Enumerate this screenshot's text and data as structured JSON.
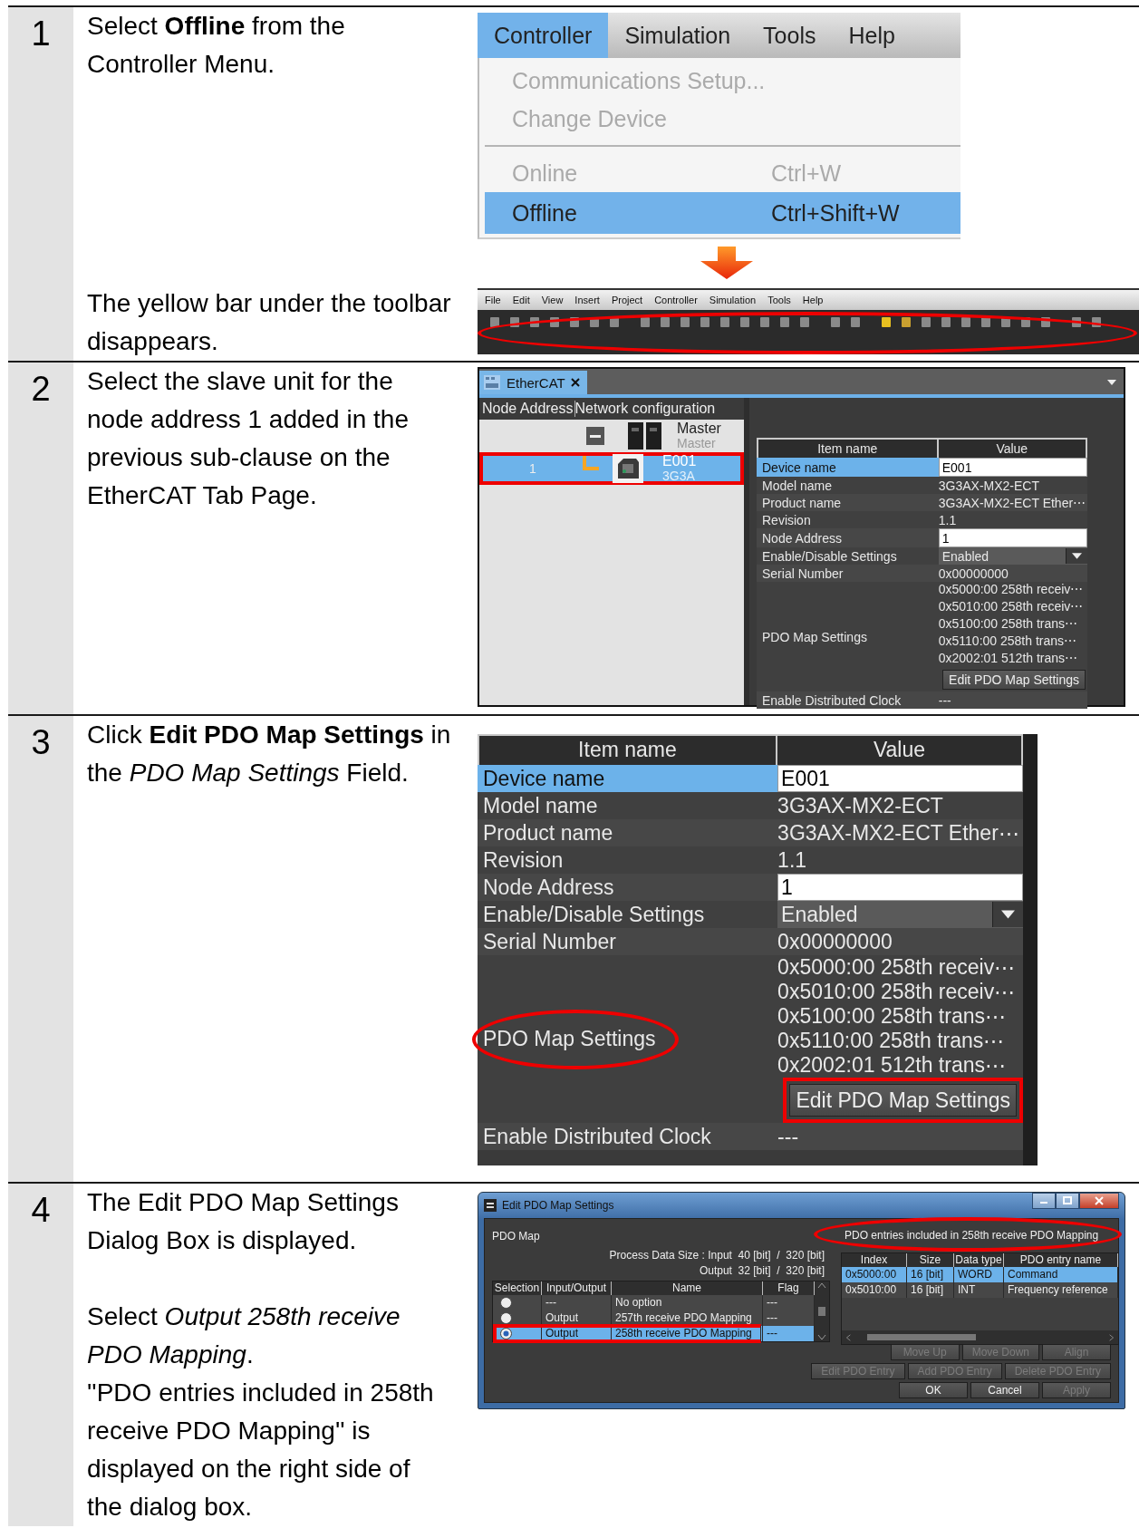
{
  "steps": [
    {
      "number": "1",
      "parts": [
        {
          "text": [
            [
              "Select **Offline** from the Controller Menu."
            ]
          ],
          "figure": {
            "kind": "menu",
            "menus": [
              {
                "label": "Controller",
                "selected": true
              },
              {
                "label": "Simulation",
                "selected": false
              },
              {
                "label": "Tools",
                "selected": false
              },
              {
                "label": "Help",
                "selected": false
              }
            ],
            "items": [
              {
                "kind": "item",
                "label": "Communications Setup...",
                "disabled": true,
                "selected": false
              },
              {
                "kind": "item",
                "label": "Change Device",
                "disabled": true,
                "selected": false
              },
              {
                "kind": "separator"
              },
              {
                "kind": "item",
                "label": "Online",
                "shortcut": "Ctrl+W",
                "disabled": true,
                "selected": false
              },
              {
                "kind": "item",
                "label": "Offline",
                "shortcut": "Ctrl+Shift+W",
                "disabled": false,
                "selected": true
              }
            ]
          }
        },
        {
          "text": [
            [
              "The yellow bar under the toolbar disappears."
            ]
          ],
          "figure": {
            "kind": "toolbar",
            "menus": [
              "File",
              "Edit",
              "View",
              "Insert",
              "Project",
              "Controller",
              "Simulation",
              "Tools",
              "Help"
            ],
            "circled": true
          }
        }
      ]
    },
    {
      "number": "2",
      "parts": [
        {
          "text": [
            [
              "Select the slave unit for the node address 1 added in the previous sub-clause on the EtherCAT Tab Page."
            ]
          ],
          "figure": {
            "kind": "ethercat",
            "tab": {
              "label": "EtherCAT",
              "selected": true
            },
            "columns": [
              "Node Address",
              "Network configuration"
            ],
            "nodes": [
              {
                "kind": "master",
                "name": "Master",
                "model": "Master",
                "selected": false,
                "highlighted": false
              },
              {
                "kind": "slave",
                "address": "1",
                "name": "E001",
                "model": "3G3A",
                "selected": true,
                "highlighted": true
              }
            ],
            "properties": {
              "columns": [
                "Item name",
                "Value"
              ],
              "rows": [
                {
                  "name": "Device name",
                  "kind": "field",
                  "value": "E001",
                  "selected": true
                },
                {
                  "name": "Model name",
                  "kind": "text",
                  "value": "3G3AX-MX2-ECT",
                  "selected": false
                },
                {
                  "name": "Product name",
                  "kind": "text",
                  "value": "3G3AX-MX2-ECT Ether⋯",
                  "selected": false
                },
                {
                  "name": "Revision",
                  "kind": "text",
                  "value": "1.1",
                  "selected": false
                },
                {
                  "name": "Node Address",
                  "kind": "field",
                  "value": "1",
                  "selected": false
                },
                {
                  "name": "Enable/Disable Settings",
                  "kind": "dropdown",
                  "value": "Enabled",
                  "selected": false
                },
                {
                  "name": "Serial Number",
                  "kind": "text",
                  "value": "0x00000000",
                  "selected": false
                },
                {
                  "name": "PDO Map Settings",
                  "kind": "list",
                  "values": [
                    "0x5000:00 258th receiv⋯",
                    "0x5010:00 258th receiv⋯",
                    "0x5100:00 258th trans⋯",
                    "0x5110:00 258th trans⋯",
                    "0x2002:01 512th trans⋯"
                  ],
                  "button": {
                    "label": "Edit PDO Map Settings",
                    "highlighted": false
                  },
                  "circled": false,
                  "selected": false
                },
                {
                  "name": "Enable Distributed Clock",
                  "kind": "text",
                  "value": "---",
                  "selected": false
                }
              ]
            }
          }
        }
      ]
    },
    {
      "number": "3",
      "parts": [
        {
          "text": [
            [
              "Click **Edit PDO Map Settings** in the *PDO Map Settings* Field."
            ]
          ],
          "figure": {
            "kind": "properties",
            "properties": {
              "columns": [
                "Item name",
                "Value"
              ],
              "rows": [
                {
                  "name": "Device name",
                  "kind": "field",
                  "value": "E001",
                  "selected": true
                },
                {
                  "name": "Model name",
                  "kind": "text",
                  "value": "3G3AX-MX2-ECT",
                  "selected": false
                },
                {
                  "name": "Product name",
                  "kind": "text",
                  "value": "3G3AX-MX2-ECT Ether⋯",
                  "selected": false
                },
                {
                  "name": "Revision",
                  "kind": "text",
                  "value": "1.1",
                  "selected": false
                },
                {
                  "name": "Node Address",
                  "kind": "field",
                  "value": "1",
                  "selected": false
                },
                {
                  "name": "Enable/Disable Settings",
                  "kind": "dropdown",
                  "value": "Enabled",
                  "selected": false
                },
                {
                  "name": "Serial Number",
                  "kind": "text",
                  "value": "0x00000000",
                  "selected": false
                },
                {
                  "name": "PDO Map Settings",
                  "kind": "list",
                  "values": [
                    "0x5000:00 258th receiv⋯",
                    "0x5010:00 258th receiv⋯",
                    "0x5100:00 258th trans⋯",
                    "0x5110:00 258th trans⋯",
                    "0x2002:01 512th trans⋯"
                  ],
                  "button": {
                    "label": "Edit PDO Map Settings",
                    "highlighted": true
                  },
                  "circled": true,
                  "selected": false
                },
                {
                  "name": "Enable Distributed Clock",
                  "kind": "text",
                  "value": "---",
                  "selected": false
                }
              ]
            }
          }
        }
      ]
    },
    {
      "number": "4",
      "parts": [
        {
          "text": [
            [
              "The Edit PDO Map Settings Dialog Box is displayed."
            ],
            [
              "Select *Output 258th receive PDO Mapping*.",
              "''PDO entries included in 258th receive PDO Mapping'' is displayed on the right side of the dialog box."
            ]
          ],
          "figure": {
            "kind": "dialog",
            "title": "Edit PDO Map Settings",
            "left": {
              "label": "PDO Map",
              "size_lines": [
                "Process Data Size : Input  40 [bit]  /  320 [bit]",
                "Output  32 [bit]  /  320 [bit]"
              ],
              "columns": [
                "Selection",
                "Input/Output",
                "Name",
                "Flag"
              ],
              "rows": [
                {
                  "io": "---",
                  "name": "No option",
                  "flag": "---",
                  "selected": false,
                  "highlighted": false
                },
                {
                  "io": "Output",
                  "name": "257th receive PDO Mapping",
                  "flag": "---",
                  "selected": false,
                  "highlighted": false
                },
                {
                  "io": "Output",
                  "name": "258th receive PDO Mapping",
                  "flag": "---",
                  "selected": true,
                  "highlighted": true
                }
              ]
            },
            "right": {
              "label": "PDO entries included in 258th receive PDO Mapping",
              "circled": true,
              "columns": [
                "Index",
                "Size",
                "Data type",
                "PDO entry name"
              ],
              "rows": [
                {
                  "cells": [
                    "0x5000:00",
                    "16 [bit]",
                    "WORD",
                    "Command"
                  ],
                  "selected": true
                },
                {
                  "cells": [
                    "0x5010:00",
                    "16 [bit]",
                    "INT",
                    "Frequency reference"
                  ],
                  "selected": false
                }
              ]
            },
            "button_rows": [
              [
                {
                  "label": "Move Up",
                  "disabled": true
                },
                {
                  "label": "Move Down",
                  "disabled": true
                },
                {
                  "label": "Align",
                  "disabled": true
                }
              ],
              [
                {
                  "label": "Edit PDO Entry",
                  "disabled": true
                },
                {
                  "label": "Add PDO Entry",
                  "disabled": true
                },
                {
                  "label": "Delete PDO Entry",
                  "disabled": true
                }
              ],
              [
                {
                  "label": "OK",
                  "disabled": false
                },
                {
                  "label": "Cancel",
                  "disabled": false
                },
                {
                  "label": "Apply",
                  "disabled": true
                }
              ]
            ]
          }
        }
      ]
    }
  ]
}
